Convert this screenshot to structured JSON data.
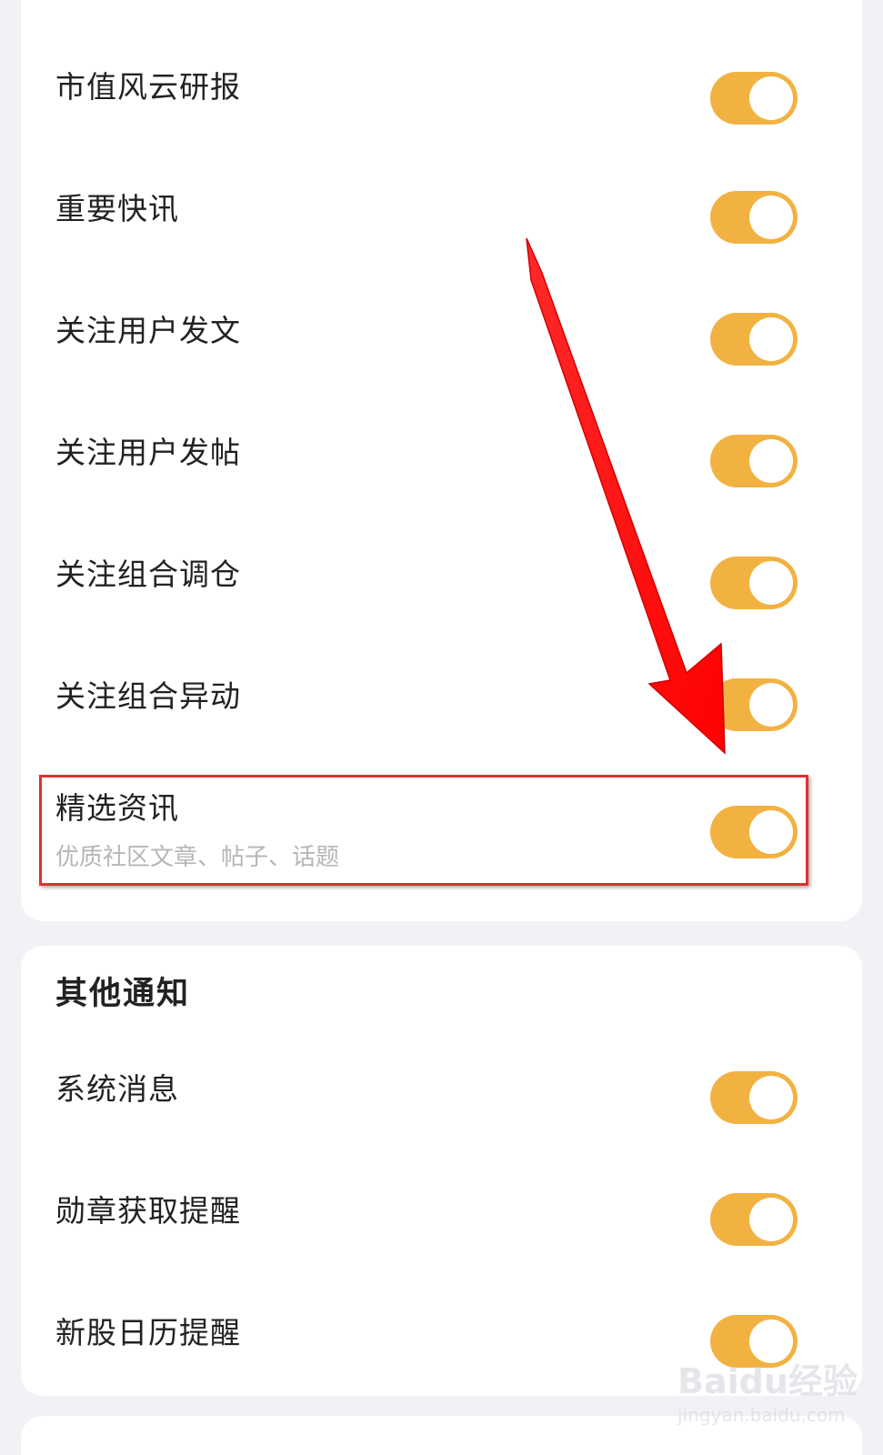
{
  "sections": {
    "subscriptions": {
      "items": [
        {
          "label": "市值风云研报",
          "enabled": true
        },
        {
          "label": "重要快讯",
          "enabled": true
        },
        {
          "label": "关注用户发文",
          "enabled": true
        },
        {
          "label": "关注用户发帖",
          "enabled": true
        },
        {
          "label": "关注组合调仓",
          "enabled": true
        },
        {
          "label": "关注组合异动",
          "enabled": true
        },
        {
          "label": "精选资讯",
          "sublabel": "优质社区文章、帖子、话题",
          "enabled": true
        }
      ]
    },
    "other": {
      "title": "其他通知",
      "items": [
        {
          "label": "系统消息",
          "enabled": true
        },
        {
          "label": "勋章获取提醒",
          "enabled": true
        },
        {
          "label": "新股日历提醒",
          "enabled": true
        }
      ]
    }
  },
  "colors": {
    "toggle_on": "#f2b242",
    "highlight": "#e03030",
    "arrow": "#ff1010"
  },
  "watermark": {
    "main": "Baidu经验",
    "sub": "jingyan.baidu.com"
  }
}
